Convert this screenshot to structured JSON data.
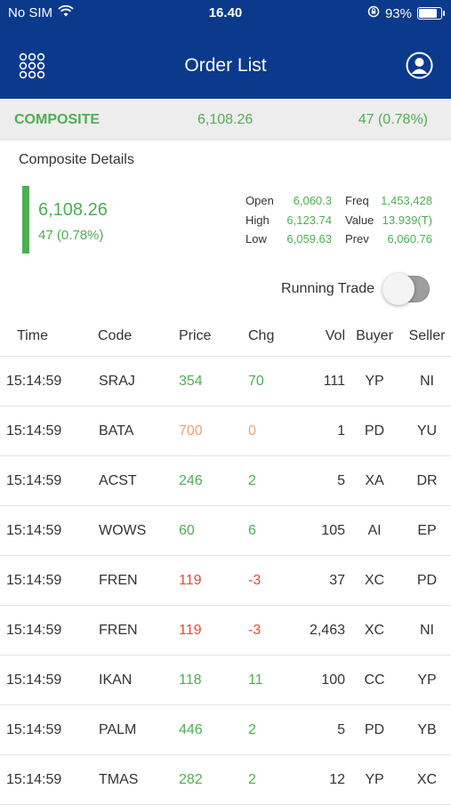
{
  "status_bar": {
    "carrier": "No SIM",
    "time": "16.40",
    "battery": "93%",
    "battery_level": 0.93
  },
  "header": {
    "title": "Order List"
  },
  "composite": {
    "name": "COMPOSITE",
    "value": "6,108.26",
    "change": "47 (0.78%)"
  },
  "details": {
    "title": "Composite Details",
    "last": "6,108.26",
    "change": "47 (0.78%)",
    "stats_left": [
      {
        "label": "Open",
        "value": "6,060.3"
      },
      {
        "label": "High",
        "value": "6,123.74"
      },
      {
        "label": "Low",
        "value": "6,059.63"
      }
    ],
    "stats_right": [
      {
        "label": "Freq",
        "value": "1,453,428"
      },
      {
        "label": "Value",
        "value": "13.939(T)"
      },
      {
        "label": "Prev",
        "value": "6,060.76"
      }
    ]
  },
  "running_trade": {
    "label": "Running Trade",
    "enabled": false
  },
  "table": {
    "headers": [
      "Time",
      "Code",
      "Price",
      "Chg",
      "Vol",
      "Buyer",
      "Seller"
    ],
    "rows": [
      {
        "time": "15:14:59",
        "code": "SRAJ",
        "price": "354",
        "chg": "70",
        "vol": "111",
        "buyer": "YP",
        "seller": "NI",
        "dir": "up"
      },
      {
        "time": "15:14:59",
        "code": "BATA",
        "price": "700",
        "chg": "0",
        "vol": "1",
        "buyer": "PD",
        "seller": "YU",
        "dir": "flat"
      },
      {
        "time": "15:14:59",
        "code": "ACST",
        "price": "246",
        "chg": "2",
        "vol": "5",
        "buyer": "XA",
        "seller": "DR",
        "dir": "up"
      },
      {
        "time": "15:14:59",
        "code": "WOWS",
        "price": "60",
        "chg": "6",
        "vol": "105",
        "buyer": "AI",
        "seller": "EP",
        "dir": "up"
      },
      {
        "time": "15:14:59",
        "code": "FREN",
        "price": "119",
        "chg": "-3",
        "vol": "37",
        "buyer": "XC",
        "seller": "PD",
        "dir": "down"
      },
      {
        "time": "15:14:59",
        "code": "FREN",
        "price": "119",
        "chg": "-3",
        "vol": "2,463",
        "buyer": "XC",
        "seller": "NI",
        "dir": "down"
      },
      {
        "time": "15:14:59",
        "code": "IKAN",
        "price": "118",
        "chg": "11",
        "vol": "100",
        "buyer": "CC",
        "seller": "YP",
        "dir": "up"
      },
      {
        "time": "15:14:59",
        "code": "PALM",
        "price": "446",
        "chg": "2",
        "vol": "5",
        "buyer": "PD",
        "seller": "YB",
        "dir": "up"
      },
      {
        "time": "15:14:59",
        "code": "TMAS",
        "price": "282",
        "chg": "2",
        "vol": "12",
        "buyer": "YP",
        "seller": "XC",
        "dir": "up"
      }
    ]
  },
  "colors": {
    "header_bg": "#0b3a8c",
    "up": "#4caf50",
    "down": "#e64a3b",
    "flat": "#f0a070",
    "composite_bg": "#ededed"
  },
  "icons": {
    "menu": "grid-icon",
    "profile": "user-icon",
    "wifi": "wifi-icon",
    "lock": "rotation-lock-icon",
    "battery": "battery-icon"
  }
}
